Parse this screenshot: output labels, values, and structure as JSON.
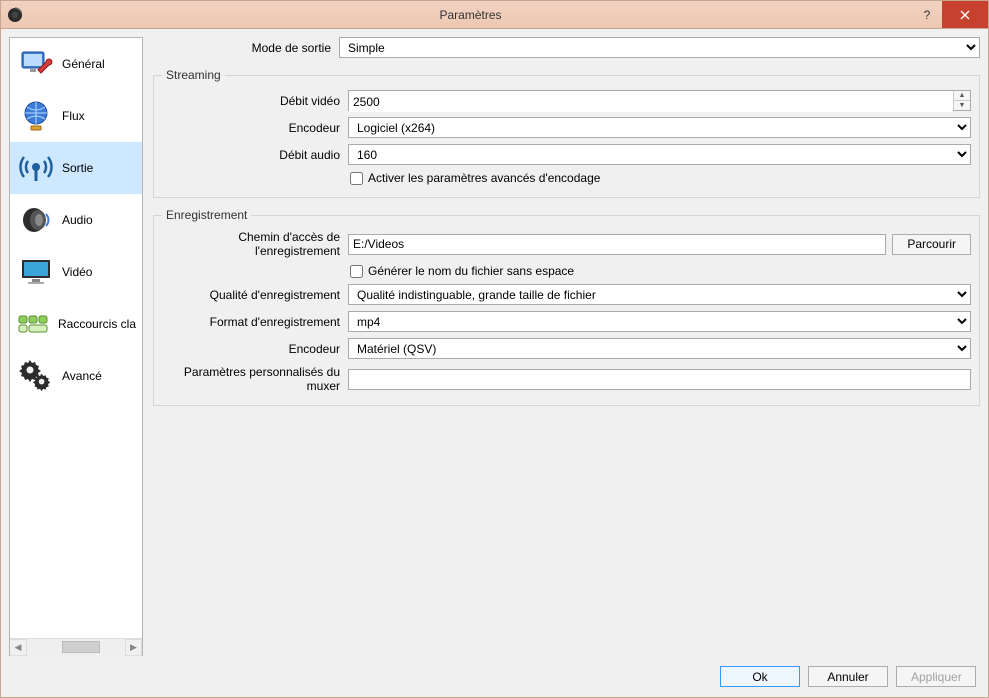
{
  "window": {
    "title": "Paramètres"
  },
  "sidebar": {
    "items": [
      {
        "label": "Général"
      },
      {
        "label": "Flux"
      },
      {
        "label": "Sortie",
        "selected": true
      },
      {
        "label": "Audio"
      },
      {
        "label": "Vidéo"
      },
      {
        "label": "Raccourcis clavier"
      },
      {
        "label": "Avancé"
      }
    ]
  },
  "output_mode": {
    "label": "Mode de sortie",
    "value": "Simple"
  },
  "streaming": {
    "legend": "Streaming",
    "video_bitrate_label": "Débit vidéo",
    "video_bitrate_value": "2500",
    "encoder_label": "Encodeur",
    "encoder_value": "Logiciel (x264)",
    "audio_bitrate_label": "Débit audio",
    "audio_bitrate_value": "160",
    "advanced_checkbox_label": "Activer les paramètres avancés d'encodage"
  },
  "recording": {
    "legend": "Enregistrement",
    "path_label": "Chemin d'accès de l'enregistrement",
    "path_value": "E:/Videos",
    "browse_label": "Parcourir",
    "nospace_checkbox_label": "Générer le nom du fichier sans espace",
    "quality_label": "Qualité d'enregistrement",
    "quality_value": "Qualité indistinguable, grande taille de fichier",
    "format_label": "Format d'enregistrement",
    "format_value": "mp4",
    "encoder_label": "Encodeur",
    "encoder_value": "Matériel (QSV)",
    "muxer_label": "Paramètres personnalisés du muxer",
    "muxer_value": ""
  },
  "footer": {
    "ok": "Ok",
    "cancel": "Annuler",
    "apply": "Appliquer"
  }
}
